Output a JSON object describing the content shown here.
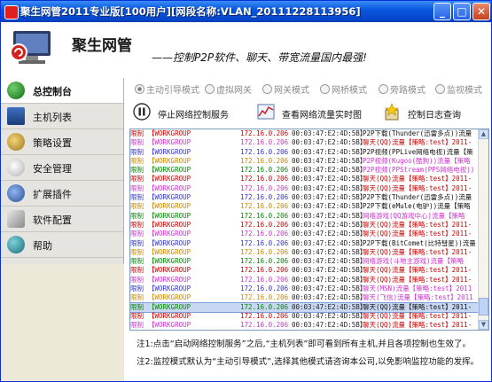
{
  "window": {
    "title": "聚生网管2011专业版[100用户][网段名称:VLAN_20111228113956]",
    "buttons": {
      "minimize": "_",
      "maximize": "□",
      "close": "✕"
    }
  },
  "header": {
    "brand": "聚生网管",
    "slogan": "——控制P2P软件、聊天、带宽流量国内最强!"
  },
  "sidebar": {
    "items": [
      {
        "label": "总控制台",
        "icon": "globe-icon",
        "active": true
      },
      {
        "label": "主机列表",
        "icon": "host-list-icon",
        "active": false
      },
      {
        "label": "策略设置",
        "icon": "policy-icon",
        "active": false
      },
      {
        "label": "安全管理",
        "icon": "security-icon",
        "active": false
      },
      {
        "label": "扩展插件",
        "icon": "plugin-icon",
        "active": false
      },
      {
        "label": "软件配置",
        "icon": "config-icon",
        "active": false
      },
      {
        "label": "帮助",
        "icon": "help-icon",
        "active": false
      }
    ]
  },
  "modes": [
    {
      "label": "主动引导模式",
      "selected": true
    },
    {
      "label": "虚拟网关",
      "selected": false
    },
    {
      "label": "网关模式",
      "selected": false
    },
    {
      "label": "网桥模式",
      "selected": false
    },
    {
      "label": "旁路模式",
      "selected": false
    },
    {
      "label": "监视模式",
      "selected": false
    }
  ],
  "toolbar": {
    "stop_label": "停止网络控制服务",
    "realtime_label": "查看网络流量实时图",
    "log_label": "控制日志查询"
  },
  "log": {
    "rows": [
      {
        "limit": "限制",
        "group": "【WORKGROUP",
        "ip": "172.16.0.206",
        "mac": "00:03:47:E2:4D:5B】",
        "msg": "P2P下载(Thunder(迅雷多点))流量",
        "msg_color": "#111111"
      },
      {
        "limit": "限制",
        "group": "【WORKGROUP",
        "ip": "172.16.0.206",
        "mac": "00:03:47:E2:4D:5B】",
        "msg": "聊天(QQ)流量【策略:test】2011-",
        "msg_color": "#cc0000"
      },
      {
        "limit": "限制",
        "group": "【WORKGROUP",
        "ip": "172.16.0.206",
        "mac": "00:03:47:E2:4D:5B】",
        "msg": "P2P视频(PPLive网络电视)流量【策",
        "msg_color": "#111111"
      },
      {
        "limit": "限制",
        "group": "【WORKGROUP",
        "ip": "172.16.0.206",
        "mac": "00:03:47:E2:4D:5B】",
        "msg": "P2P视频(Kugoo(酷狗))流量【策略",
        "msg_color": "#cc33cc"
      },
      {
        "limit": "限制",
        "group": "【WORKGROUP",
        "ip": "172.16.0.206",
        "mac": "00:03:47:E2:4D:5B】",
        "msg": "P2P视频(PPStream(PPS网络电视))",
        "msg_color": "#cc33cc"
      },
      {
        "limit": "限制",
        "group": "【WORKGROUP",
        "ip": "172.16.0.206",
        "mac": "00:03:47:E2:4D:5B】",
        "msg": "聊天(QQ)流量【策略:test】2011-",
        "msg_color": "#cc0000"
      },
      {
        "limit": "限制",
        "group": "【WORKGROUP",
        "ip": "172.16.0.206",
        "mac": "00:03:47:E2:4D:5B】",
        "msg": "聊天(QQ)流量【策略:test】2011-",
        "msg_color": "#cc0000"
      },
      {
        "limit": "限制",
        "group": "【WORKGROUP",
        "ip": "172.16.0.206",
        "mac": "00:03:47:E2:4D:5B】",
        "msg": "P2P下载(Thunder(迅雷多点))流量",
        "msg_color": "#111111"
      },
      {
        "limit": "限制",
        "group": "【WORKGROUP",
        "ip": "172.16.0.206",
        "mac": "00:03:47:E2:4D:5B】",
        "msg": "P2P下载(eMule(电驴))流量【策略",
        "msg_color": "#111111"
      },
      {
        "limit": "限制",
        "group": "【WORKGROUP",
        "ip": "172.16.0.206",
        "mac": "00:03:47:E2:4D:5B】",
        "msg": "网络游戏(QQ游戏中心)流量【策略",
        "msg_color": "#cc33cc"
      },
      {
        "limit": "限制",
        "group": "【WORKGROUP",
        "ip": "172.16.0.206",
        "mac": "00:03:47:E2:4D:5B】",
        "msg": "聊天(QQ)流量【策略:test】2011-",
        "msg_color": "#cc0000"
      },
      {
        "limit": "限制",
        "group": "【WORKGROUP",
        "ip": "172.16.0.206",
        "mac": "00:03:47:E2:4D:5B】",
        "msg": "聊天(QQ)流量【策略:test】2011-",
        "msg_color": "#cc0000"
      },
      {
        "limit": "限制",
        "group": "【WORKGROUP",
        "ip": "172.16.0.206",
        "mac": "00:03:47:E2:4D:5B】",
        "msg": "P2P下载(BitComet(比特彗星))流量",
        "msg_color": "#111111"
      },
      {
        "limit": "限制",
        "group": "【WORKGROUP",
        "ip": "172.16.0.206",
        "mac": "00:03:47:E2:4D:5B】",
        "msg": "聊天(QQ)流量【策略:test】2011-",
        "msg_color": "#cc0000"
      },
      {
        "limit": "限制",
        "group": "【WORKGROUP",
        "ip": "172.16.0.206",
        "mac": "00:03:47:E2:4D:5B】",
        "msg": "网络游戏(斗地主游戏)流量【策略",
        "msg_color": "#cc33cc"
      },
      {
        "limit": "限制",
        "group": "【WORKGROUP",
        "ip": "172.16.0.206",
        "mac": "00:03:47:E2:4D:5B】",
        "msg": "聊天(QQ)流量【策略:test】2011-",
        "msg_color": "#cc0000"
      },
      {
        "limit": "限制",
        "group": "【WORKGROUP",
        "ip": "172.16.0.206",
        "mac": "00:03:47:E2:4D:5B】",
        "msg": "聊天(QQ)流量【策略:test】2011-",
        "msg_color": "#cc0000"
      },
      {
        "limit": "限制",
        "group": "【WORKGROUP",
        "ip": "172.16.0.206",
        "mac": "00:03:47:E2:4D:5B】",
        "msg": "聊天(MSN)流量【策略:test】2011",
        "msg_color": "#cc33cc"
      },
      {
        "limit": "限制",
        "group": "【WORKGROUP",
        "ip": "172.16.0.206",
        "mac": "00:03:47:E2:4D:5B】",
        "msg": "聊天(飞信)流量【策略:test】2011",
        "msg_color": "#cc33cc"
      },
      {
        "limit": "限制",
        "group": "【WORKGROUP",
        "ip": "172.16.0.206",
        "mac": "00:03:47:E2:4D:5B】",
        "msg": "聊天(QQ)流量【策略:test】2011-",
        "msg_color": "#111111",
        "selected": true
      },
      {
        "limit": "限制",
        "group": "【WORKGROUP",
        "ip": "172.16.0.206",
        "mac": "00:03:47:E2:4D:5B】",
        "msg": "聊天(QQ)流量【策略:test】2011-",
        "msg_color": "#cc0000"
      },
      {
        "limit": "限制",
        "group": "【WORKGROUP",
        "ip": "172.16.0.206",
        "mac": "00:03:47:E2:4D:5B】",
        "msg": "聊天(QQ)流量【策略:test】2011-",
        "msg_color": "#cc0000"
      },
      {
        "limit": "限制",
        "group": "【WORKGROUP",
        "ip": "172.16.0.206",
        "mac": "00:03:47:E2:4D:5B】",
        "msg": "网络游戏(开心网游戏)流量【策略",
        "msg_color": "#cc33cc"
      },
      {
        "limit": "限制",
        "group": "【WORKGROUP",
        "ip": "172.16.0.206",
        "mac": "00:03:47:E2:4D:5B】",
        "msg": "股票软件(大智慧)流量【策略:te",
        "msg_color": "#cc33cc"
      }
    ],
    "row_group_colors": [
      "#cc0000",
      "#cc33cc",
      "#3333cc",
      "#cc8800",
      "#008800"
    ]
  },
  "notes": {
    "note1": "注1:点击“启动网络控制服务”之后,“主机列表”即可看到所有主机,并且各项控制也生效了。",
    "note2": "注2:监控模式默认为“主动引导模式”,选择其他模式请咨询本公司,以免影响监控功能的发挥。"
  },
  "colors": {
    "titlebar": "#0a58e0",
    "accent_red": "#cc0000"
  }
}
